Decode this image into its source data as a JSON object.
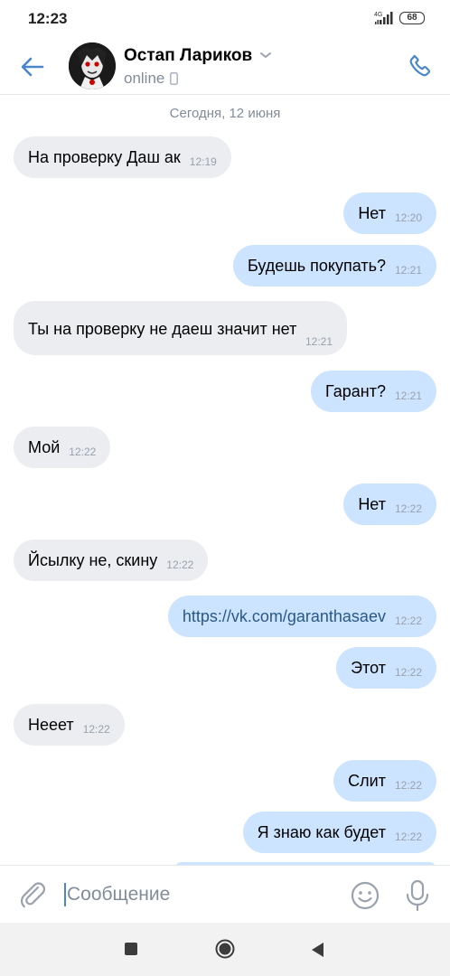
{
  "status_bar": {
    "time": "12:23",
    "network": "4G",
    "battery": "68"
  },
  "header": {
    "name": "Остап Лариков",
    "status": "online"
  },
  "date_separator": "Сегодня, 12 июня",
  "messages": [
    {
      "dir": "in",
      "text": "На проверку Даш ак",
      "time": "12:19"
    },
    {
      "dir": "out",
      "text": "Нет",
      "time": "12:20"
    },
    {
      "dir": "out",
      "text": "Будешь покупать?",
      "time": "12:21"
    },
    {
      "dir": "in",
      "text": "Ты на проверку не даеш значит нет",
      "time": "12:21"
    },
    {
      "dir": "out",
      "text": "Гарант?",
      "time": "12:21"
    },
    {
      "dir": "in",
      "text": "Мой",
      "time": "12:22"
    },
    {
      "dir": "out",
      "text": "Нет",
      "time": "12:22"
    },
    {
      "dir": "in",
      "text": "Йсылку не, скину",
      "time": "12:22"
    },
    {
      "dir": "out",
      "text": "https://vk.com/garanthasaev",
      "time": "12:22"
    },
    {
      "dir": "out",
      "text": "Этот",
      "time": "12:22"
    },
    {
      "dir": "in",
      "text": "Нееет",
      "time": "12:22"
    },
    {
      "dir": "out",
      "text": "Слит",
      "time": "12:22"
    },
    {
      "dir": "out",
      "text": "Я знаю как будет",
      "time": "12:22"
    }
  ],
  "composer": {
    "placeholder": "Сообщение"
  },
  "colors": {
    "accent": "#4986cc",
    "incoming_bubble": "#ebedf0",
    "outgoing_bubble": "#cce4ff",
    "link": "#2a5885",
    "secondary_text": "#818c99"
  },
  "icons": [
    "back-arrow-icon",
    "chevron-down-icon",
    "mobile-phone-icon",
    "phone-icon",
    "paperclip-icon",
    "smile-icon",
    "microphone-icon"
  ]
}
